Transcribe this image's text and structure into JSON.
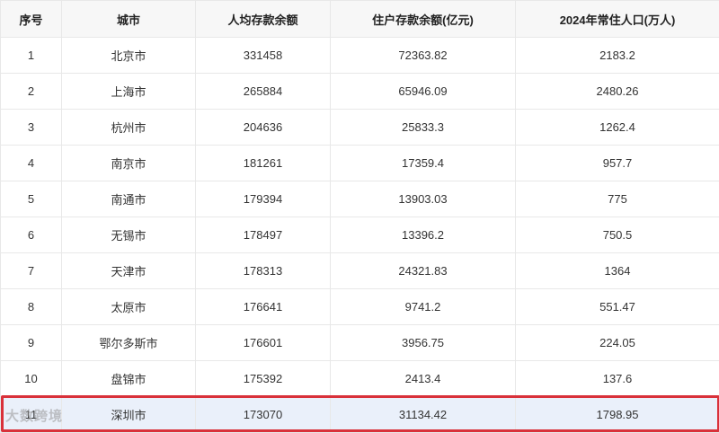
{
  "headers": [
    "序号",
    "城市",
    "人均存款余额",
    "住户存款余额(亿元)",
    "2024年常住人口(万人)"
  ],
  "rows": [
    [
      "1",
      "北京市",
      "331458",
      "72363.82",
      "2183.2"
    ],
    [
      "2",
      "上海市",
      "265884",
      "65946.09",
      "2480.26"
    ],
    [
      "3",
      "杭州市",
      "204636",
      "25833.3",
      "1262.4"
    ],
    [
      "4",
      "南京市",
      "181261",
      "17359.4",
      "957.7"
    ],
    [
      "5",
      "南通市",
      "179394",
      "13903.03",
      "775"
    ],
    [
      "6",
      "无锡市",
      "178497",
      "13396.2",
      "750.5"
    ],
    [
      "7",
      "天津市",
      "178313",
      "24321.83",
      "1364"
    ],
    [
      "8",
      "太原市",
      "176641",
      "9741.2",
      "551.47"
    ],
    [
      "9",
      "鄂尔多斯市",
      "176601",
      "3956.75",
      "224.05"
    ],
    [
      "10",
      "盘锦市",
      "175392",
      "2413.4",
      "137.6"
    ],
    [
      "11",
      "深圳市",
      "173070",
      "31134.42",
      "1798.95"
    ]
  ],
  "highlight_row": 11,
  "highlight_color": "#d9313a",
  "watermark": "大数跨境"
}
